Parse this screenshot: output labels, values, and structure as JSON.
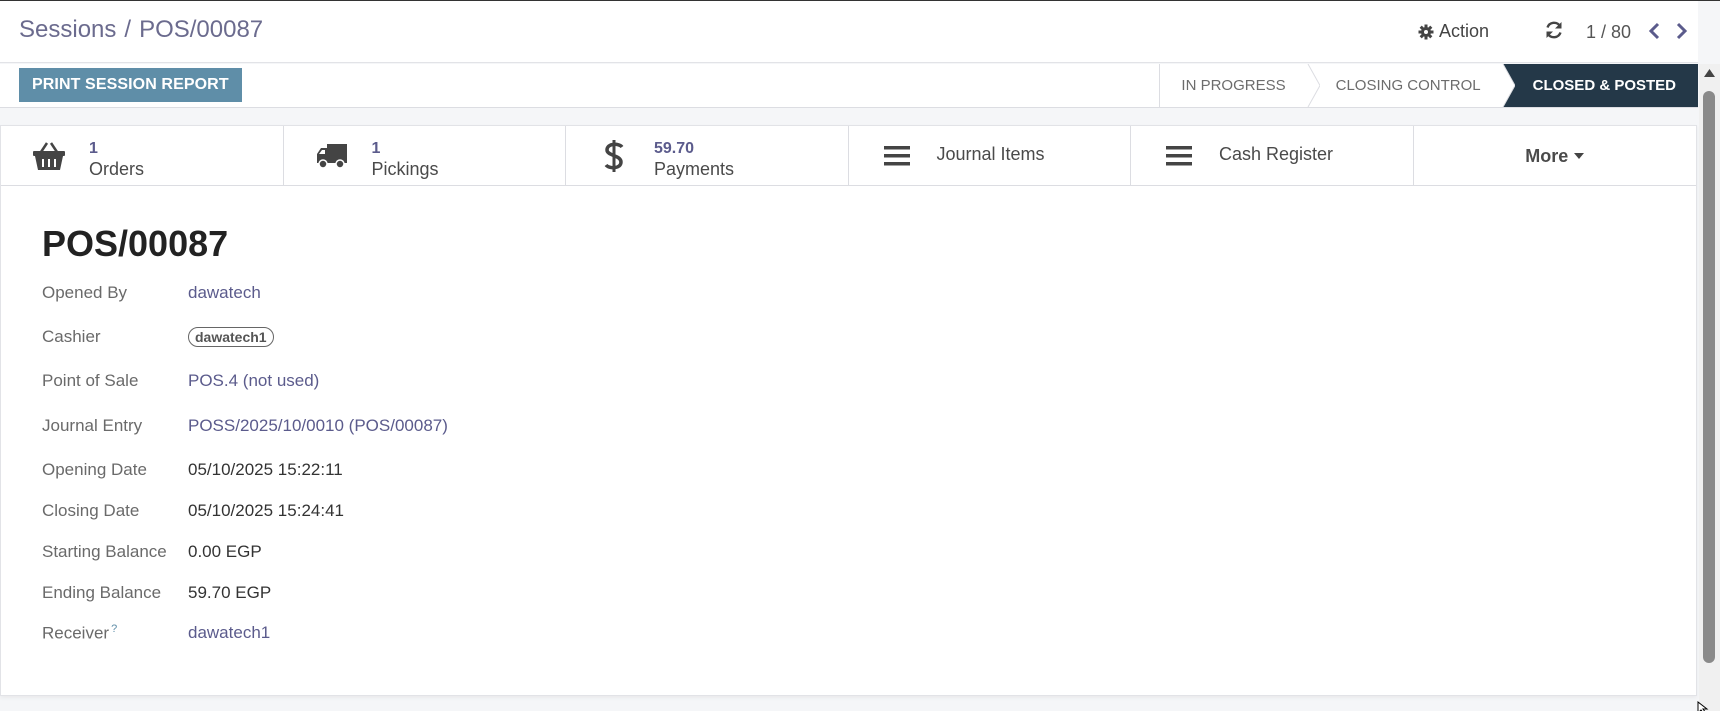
{
  "breadcrumb": {
    "parent": "Sessions",
    "separator": "/",
    "current": "POS/00087"
  },
  "toolbar": {
    "action_label": "Action",
    "pager_text": "1 / 80"
  },
  "header": {
    "print_button": "PRINT SESSION REPORT",
    "stages": [
      "IN PROGRESS",
      "CLOSING CONTROL",
      "CLOSED & POSTED"
    ],
    "active_stage": "CLOSED & POSTED"
  },
  "smart_buttons": {
    "orders": {
      "value": "1",
      "label": "Orders",
      "icon": "basket-icon"
    },
    "pickings": {
      "value": "1",
      "label": "Pickings",
      "icon": "truck-icon"
    },
    "payments": {
      "value": "59.70",
      "label": "Payments",
      "icon": "dollar-icon"
    },
    "journal_items": {
      "label": "Journal Items",
      "icon": "list-icon"
    },
    "cash_register": {
      "label": "Cash Register",
      "icon": "list-icon"
    },
    "more": {
      "label": "More",
      "icon": "caret-down-icon"
    }
  },
  "record": {
    "name": "POS/00087",
    "fields": [
      {
        "label": "Opened By",
        "value": "dawatech"
      },
      {
        "label": "Cashier",
        "value": "dawatech1"
      },
      {
        "label": "Point of Sale",
        "value": "POS.4 (not used)"
      },
      {
        "label": "Journal Entry",
        "value": "POSS/2025/10/0010 (POS/00087)"
      },
      {
        "label": "Opening Date",
        "value": "05/10/2025 15:22:11"
      },
      {
        "label": "Closing Date",
        "value": "05/10/2025 15:24:41"
      },
      {
        "label": "Starting Balance",
        "value": "0.00 EGP"
      },
      {
        "label": "Ending Balance",
        "value": "59.70 EGP"
      },
      {
        "label": "Receiver",
        "value": "dawatech1",
        "help": "?"
      }
    ]
  },
  "colors": {
    "primary": "#5f8ea8",
    "active_stage": "#243848",
    "link": "#5b5b8c"
  }
}
